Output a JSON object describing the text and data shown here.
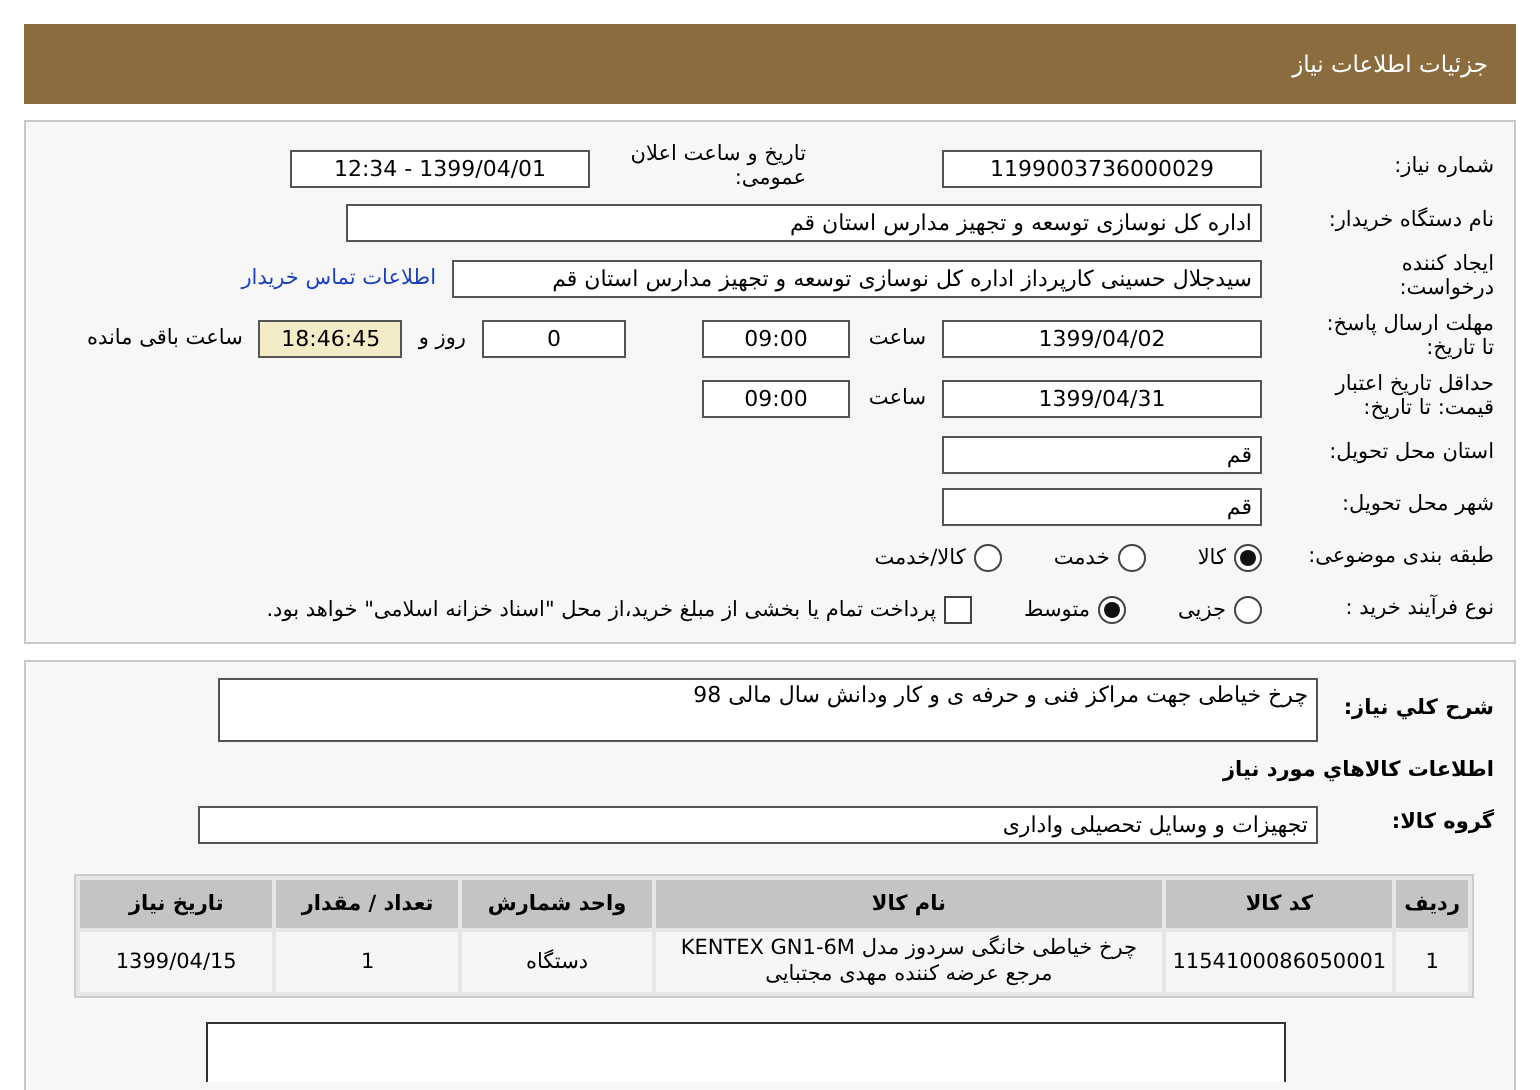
{
  "header": {
    "title": "جزئیات اطلاعات نیاز"
  },
  "need_number": {
    "label": "شماره نیاز:",
    "value": "1199003736000029"
  },
  "announce": {
    "label": "تاریخ و ساعت اعلان عمومی:",
    "value": "1399/04/01 - 12:34"
  },
  "buyer": {
    "label": "نام دستگاه خریدار:",
    "value": "اداره کل نوسازی توسعه و تجهیز مدارس استان قم"
  },
  "creator": {
    "label_lines": [
      "ایجاد کننده",
      "درخواست:"
    ],
    "value": "سیدجلال حسینی کارپرداز اداره کل نوسازی توسعه و تجهیز مدارس استان قم",
    "link": "اطلاعات تماس خریدار"
  },
  "deadline": {
    "label_lines": [
      "مهلت ارسال پاسخ:",
      "تا تاریخ:"
    ],
    "date": "1399/04/02",
    "time_label": "ساعت",
    "time": "09:00",
    "days": "0",
    "days_label": "روز و",
    "remaining": "18:46:45",
    "remaining_label": "ساعت باقی مانده"
  },
  "validity": {
    "label_lines": [
      "حداقل تاریخ اعتبار",
      "قیمت: تا تاریخ:"
    ],
    "date": "1399/04/31",
    "time_label": "ساعت",
    "time": "09:00"
  },
  "province": {
    "label": "استان محل تحویل:",
    "value": "قم"
  },
  "city": {
    "label": "شهر محل تحویل:",
    "value": "قم"
  },
  "category": {
    "label": "طبقه بندی موضوعی:",
    "options": [
      {
        "label": "کالا",
        "selected": true
      },
      {
        "label": "خدمت",
        "selected": false
      },
      {
        "label": "کالا/خدمت",
        "selected": false
      }
    ]
  },
  "process": {
    "label": "نوع فرآیند خرید :",
    "options": [
      {
        "label": "جزیی",
        "selected": false
      },
      {
        "label": "متوسط",
        "selected": true
      }
    ],
    "treasury": {
      "label": "پرداخت تمام یا بخشی از مبلغ خرید،از محل \"اسناد خزانه اسلامی\" خواهد بود.",
      "checked": false
    }
  },
  "description": {
    "label": "شرح کلي نیاز:",
    "value": "چرخ خیاطی جهت مراکز فنی و حرفه ی و کار ودانش سال مالی 98"
  },
  "goods_title": "اطلاعات کالاهاي مورد نیاز",
  "group": {
    "label": "گروه کالا:",
    "value": "تجهیزات و وسایل تحصیلی واداری"
  },
  "table": {
    "columns": [
      "ردیف",
      "کد کالا",
      "نام کالا",
      "واحد شمارش",
      "تعداد / مقدار",
      "تاریخ نیاز"
    ],
    "rows": [
      [
        "1",
        "1154100086050001",
        "چرخ خیاطی خانگی سردوز مدل KENTEX GN1-6M مرجع عرضه کننده مهدی مجتبایی",
        "دستگاه",
        "1",
        "1399/04/15"
      ]
    ]
  }
}
